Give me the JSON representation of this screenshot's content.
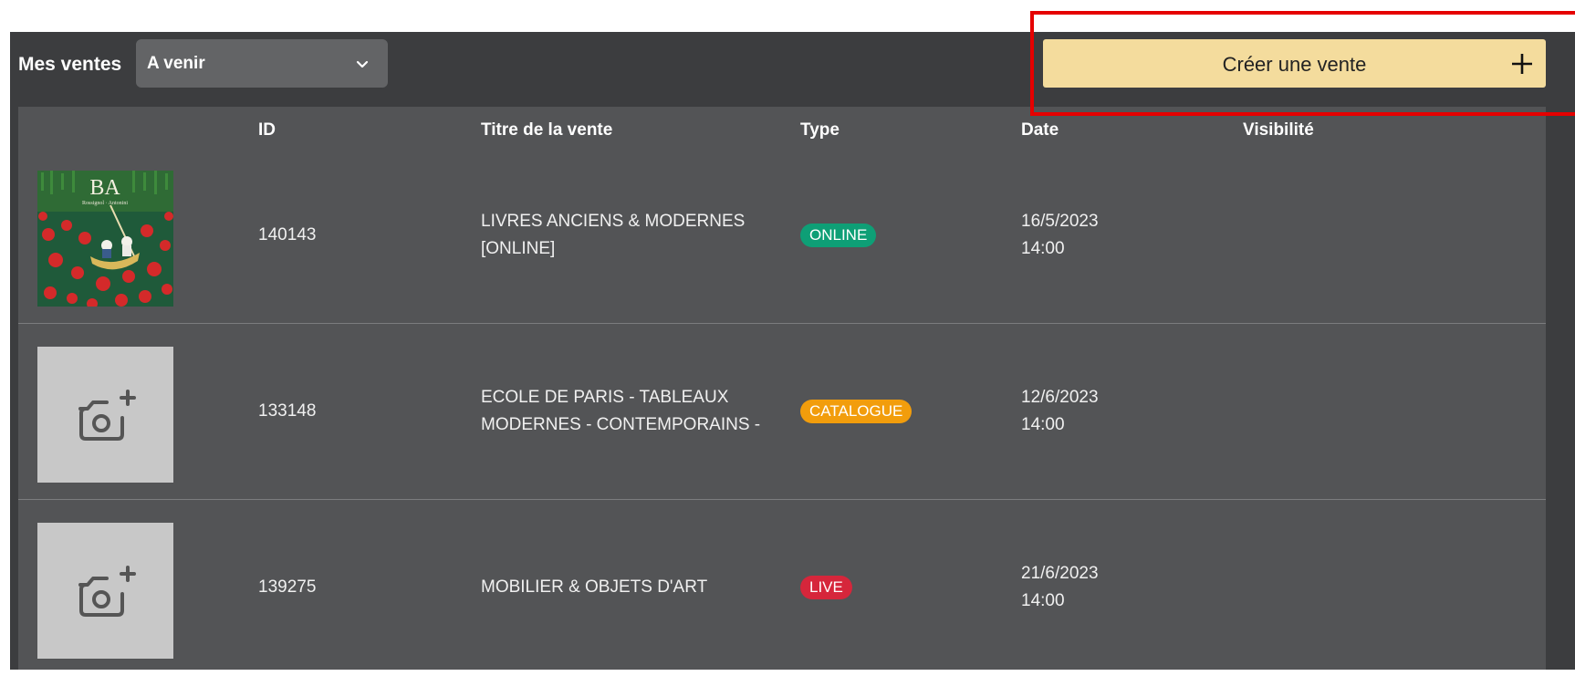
{
  "header": {
    "title": "Mes ventes",
    "filter_value": "A venir",
    "create_button_label": "Créer une vente"
  },
  "table": {
    "columns": [
      "ID",
      "Titre de la vente",
      "Type",
      "Date",
      "Visibilité"
    ],
    "rows": [
      {
        "id": "140143",
        "title_line1": "LIVRES ANCIENS & MODERNES",
        "title_line2": "[ONLINE]",
        "type": "ONLINE",
        "type_color": "#0e9f76",
        "date": "16/5/2023",
        "time": "14:00",
        "image": "cover",
        "cover_text": "BA",
        "cover_subtext": "Rossignol · Antonini"
      },
      {
        "id": "133148",
        "title_line1": "ECOLE DE PARIS - TABLEAUX",
        "title_line2": "MODERNES - CONTEMPORAINS -",
        "type": "CATALOGUE",
        "type_color": "#f29d0c",
        "date": "12/6/2023",
        "time": "14:00",
        "image": "add-photo-icon"
      },
      {
        "id": "139275",
        "title_line1": "MOBILIER & OBJETS D'ART",
        "title_line2": "",
        "type": "LIVE",
        "type_color": "#d6263b",
        "date": "21/6/2023",
        "time": "14:00",
        "image": "add-photo-icon"
      }
    ]
  },
  "colors": {
    "accent_button": "#f4dc9d",
    "highlight_frame": "#e50000",
    "panel": "#3c3d3f",
    "table_bg": "#535456"
  }
}
